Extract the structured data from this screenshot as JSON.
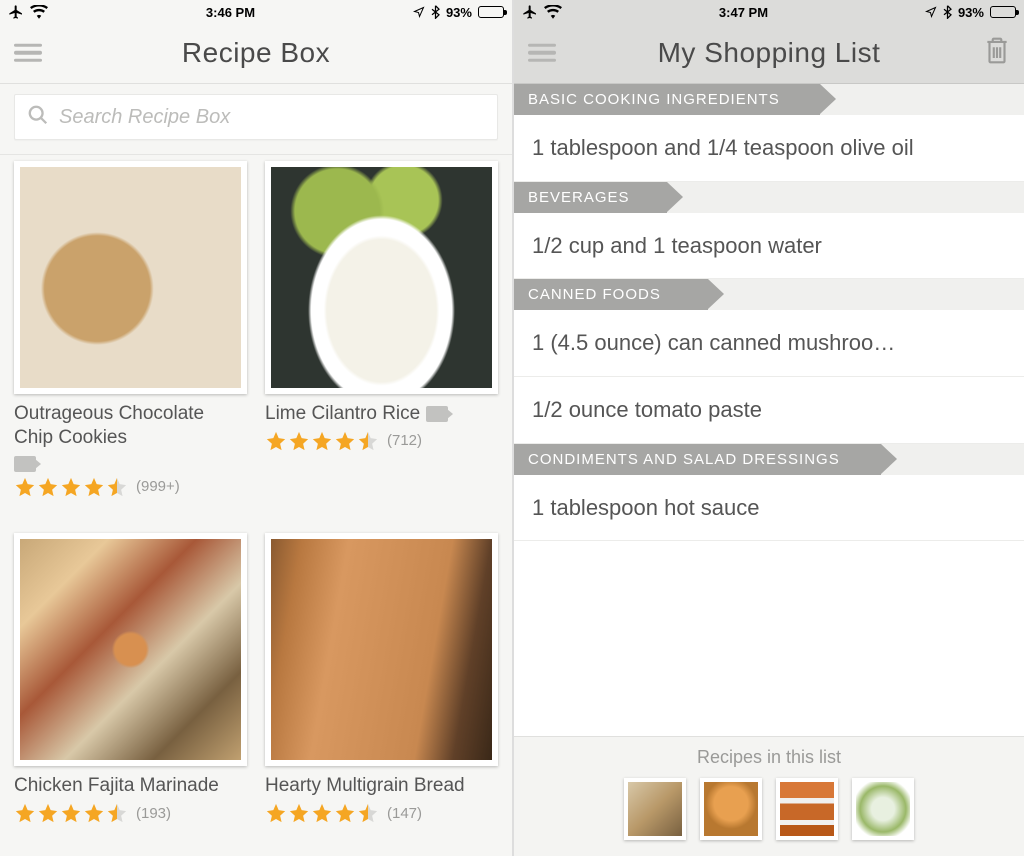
{
  "left": {
    "status": {
      "time": "3:46 PM",
      "battery_pct": "93%"
    },
    "nav": {
      "title": "Recipe Box"
    },
    "search": {
      "placeholder": "Search Recipe Box"
    },
    "recipes": [
      {
        "title": "Outrageous Chocolate Chip Cookies",
        "has_video": true,
        "rating": 4.5,
        "reviews": "(999+)"
      },
      {
        "title": "Lime Cilantro Rice",
        "has_video": true,
        "rating": 4.5,
        "reviews": "(712)"
      },
      {
        "title": "Chicken Fajita Marinade",
        "has_video": false,
        "rating": 4.5,
        "reviews": "(193)"
      },
      {
        "title": "Hearty Multigrain Bread",
        "has_video": false,
        "rating": 4.5,
        "reviews": "(147)"
      }
    ]
  },
  "right": {
    "status": {
      "time": "3:47 PM",
      "battery_pct": "93%"
    },
    "nav": {
      "title": "My Shopping List"
    },
    "sections": [
      {
        "header": "BASIC COOKING INGREDIENTS",
        "items": [
          "1 tablespoon and 1/4 teaspoon olive oil"
        ],
        "wrap": true
      },
      {
        "header": "BEVERAGES",
        "items": [
          "1/2 cup and 1 teaspoon water"
        ]
      },
      {
        "header": "CANNED FOODS",
        "items": [
          "1 (4.5 ounce) can canned mushroo…",
          "1/2 ounce tomato paste"
        ]
      },
      {
        "header": "CONDIMENTS AND SALAD DRESSINGS",
        "items": [
          "1 tablespoon hot sauce"
        ]
      }
    ],
    "footer": {
      "title": "Recipes in this list",
      "count": 4
    }
  }
}
